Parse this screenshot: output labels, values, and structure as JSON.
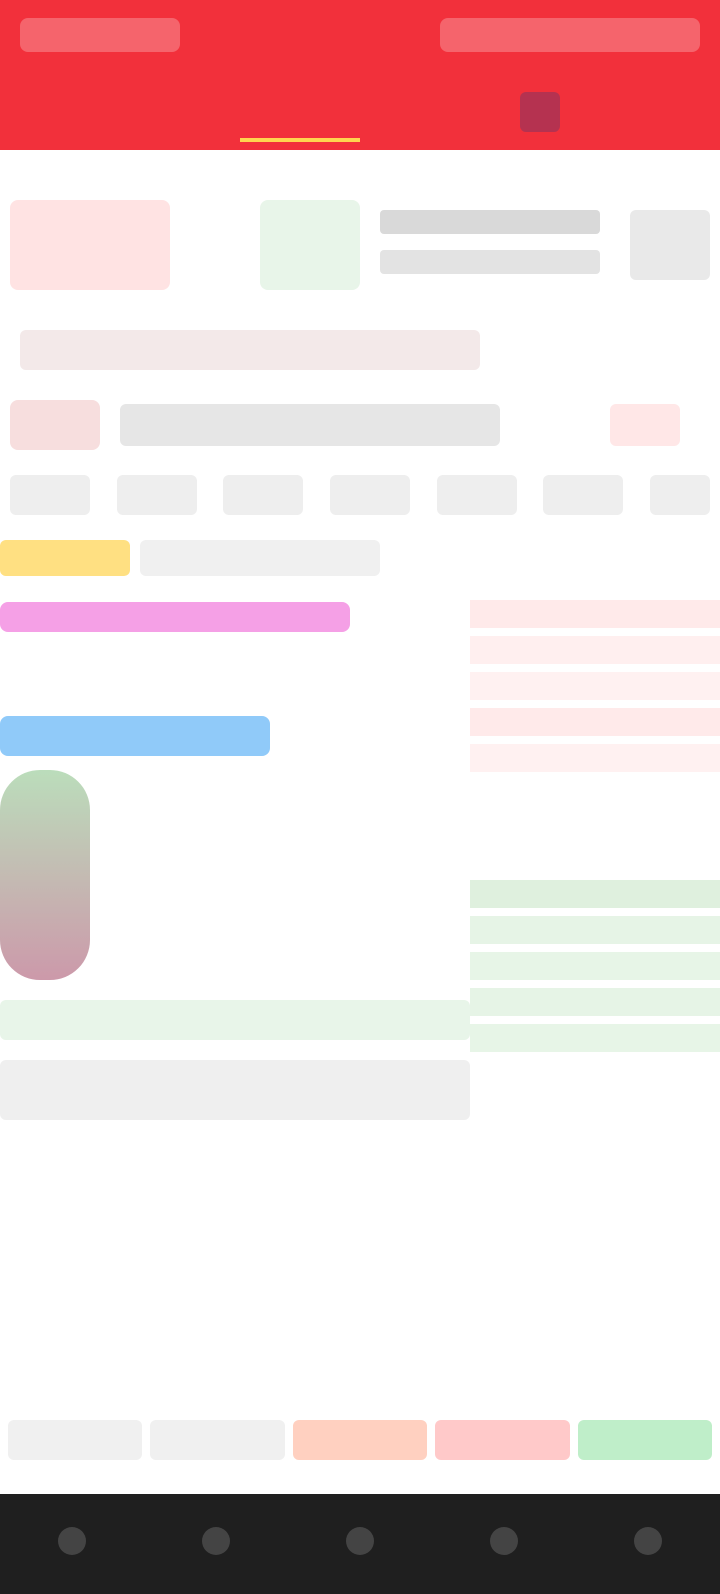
{
  "header": {
    "left_title": "",
    "right_info": "",
    "tabs": [
      {
        "label": ""
      },
      {
        "label": ""
      },
      {
        "label": ""
      },
      {
        "label": ""
      },
      {
        "label": ""
      },
      {
        "label": ""
      }
    ]
  },
  "summary": {
    "price": "",
    "change": "",
    "metrics": [
      "",
      "",
      ""
    ]
  },
  "stock_title": {
    "name": "",
    "code": ""
  },
  "timeframes": [
    "",
    "",
    "",
    "",
    "",
    "",
    ""
  ],
  "chips": [
    "",
    ""
  ],
  "order_book": {
    "rows": [
      {
        "price": "",
        "vol": "",
        "side": ""
      },
      {
        "price": "",
        "vol": "",
        "side": ""
      },
      {
        "price": "",
        "vol": "",
        "side": ""
      },
      {
        "price": "",
        "vol": "",
        "side": ""
      },
      {
        "price": "",
        "vol": "",
        "side": ""
      },
      {
        "price": "",
        "vol": "",
        "side": ""
      },
      {
        "price": "",
        "vol": "",
        "side": ""
      },
      {
        "price": "",
        "vol": "",
        "side": ""
      },
      {
        "price": "",
        "vol": "",
        "side": ""
      },
      {
        "price": "",
        "vol": "",
        "side": ""
      }
    ]
  },
  "bottom_actions": [
    "",
    "",
    "",
    "",
    ""
  ],
  "nav": {
    "items": [
      {
        "label": ""
      },
      {
        "label": ""
      },
      {
        "label": ""
      },
      {
        "label": ""
      },
      {
        "label": ""
      }
    ]
  },
  "colors": {
    "header": "#f2303b",
    "bar_dark": "#1f1f1f",
    "accent_red": "#e53935",
    "accent_green": "#2e7d32",
    "pink": "#f5a0e6",
    "blue": "#90caf9",
    "yellow": "#ffe082"
  }
}
